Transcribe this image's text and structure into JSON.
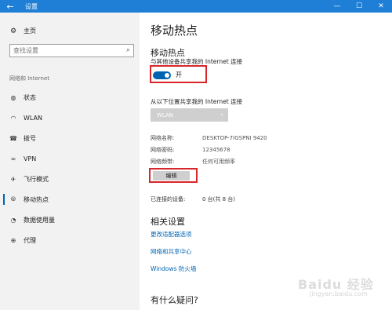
{
  "titlebar": {
    "back_icon": "arrow-left-icon",
    "title": "设置",
    "minimize": "—",
    "maximize": "☐",
    "close": "✕"
  },
  "sidebar": {
    "home": {
      "label": "主页",
      "icon": "gear-icon"
    },
    "search": {
      "placeholder": "查找设置",
      "icon": "search-icon"
    },
    "section_label": "网络和 Internet",
    "items": [
      {
        "label": "状态",
        "icon": "globe-icon",
        "active": false
      },
      {
        "label": "WLAN",
        "icon": "wifi-icon",
        "active": false
      },
      {
        "label": "拨号",
        "icon": "phone-icon",
        "active": false
      },
      {
        "label": "VPN",
        "icon": "vpn-icon",
        "active": false
      },
      {
        "label": "飞行模式",
        "icon": "airplane-icon",
        "active": false
      },
      {
        "label": "移动热点",
        "icon": "hotspot-icon",
        "active": true
      },
      {
        "label": "数据使用量",
        "icon": "data-usage-icon",
        "active": false
      },
      {
        "label": "代理",
        "icon": "globe-icon",
        "active": false
      }
    ]
  },
  "main": {
    "title": "移动热点",
    "subtitle": "移动热点",
    "share_desc": "与其他设备共享我的 Internet 连接",
    "toggle": {
      "state": "on",
      "label": "开"
    },
    "share_from_label": "从以下位置共享我的 Internet 连接",
    "share_from_value": "WLAN",
    "network": [
      {
        "key": "网络名称:",
        "value": "DESKTOP-7IGSPNI 9420"
      },
      {
        "key": "网络密码:",
        "value": "12345678"
      },
      {
        "key": "网络频带:",
        "value": "任何可用频率"
      }
    ],
    "edit_label": "编辑",
    "connected": {
      "key": "已连接的设备:",
      "value": "0 台(共 8 台)"
    },
    "related_title": "相关设置",
    "links": [
      "更改适配器选项",
      "网络和共享中心",
      "Windows 防火墙"
    ],
    "question_title": "有什么疑问?"
  },
  "watermark": {
    "text": "Baidu 经验",
    "sub": "jingyan.baidu.com"
  },
  "colors": {
    "accent": "#0063b1",
    "titlebar": "#1f7fd6",
    "highlight": "#d9262b"
  }
}
